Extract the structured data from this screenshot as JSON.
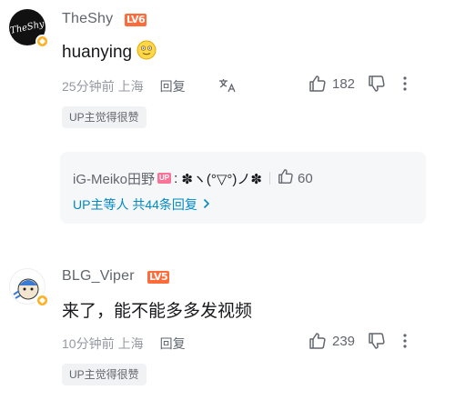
{
  "comments": [
    {
      "username": "TheShy",
      "level": "LV6",
      "content": "huanying",
      "time": "25分钟前",
      "location": "上海",
      "reply_label": "回复",
      "likes": "182",
      "up_tag": "UP主觉得很赞"
    },
    {
      "username": "BLG_Viper",
      "level": "LV5",
      "content": "来了，能不能多多发视频",
      "time": "10分钟前",
      "location": "上海",
      "reply_label": "回复",
      "likes": "239",
      "up_tag": "UP主觉得很赞"
    }
  ],
  "sub_reply": {
    "username": "iG-Meiko田野",
    "badge": "UP",
    "text": "✽ヽ(°▽°)ノ✽",
    "likes": "60",
    "more_label": "UP主等人 共44条回复"
  },
  "colors": {
    "level_badge": "#ff6b39",
    "link_blue": "#008ac5",
    "vip_badge": "#ffb027",
    "up_badge": "#fb7299"
  }
}
